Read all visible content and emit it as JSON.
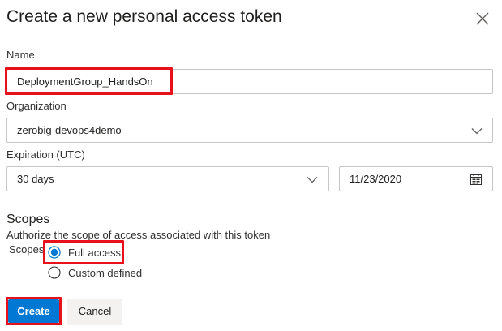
{
  "dialog": {
    "title": "Create a new personal access token"
  },
  "name": {
    "label": "Name",
    "value": "DeploymentGroup_HandsOn"
  },
  "organization": {
    "label": "Organization",
    "value": "zerobig-devops4demo"
  },
  "expiration": {
    "label": "Expiration (UTC)",
    "value": "30 days",
    "date": "11/23/2020"
  },
  "scopes": {
    "heading": "Scopes",
    "description": "Authorize the scope of access associated with this token",
    "label": "Scopes",
    "options": [
      {
        "label": "Full access",
        "selected": true
      },
      {
        "label": "Custom defined",
        "selected": false
      }
    ]
  },
  "actions": {
    "create_label": "Create",
    "cancel_label": "Cancel"
  },
  "colors": {
    "accent": "#0078d4",
    "highlight": "#e8101a"
  },
  "icons": [
    "close-icon",
    "chevron-down-icon",
    "calendar-icon"
  ]
}
